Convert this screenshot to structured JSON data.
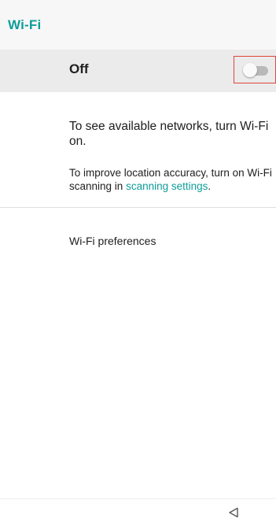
{
  "app_bar": {
    "title": "Wi-Fi"
  },
  "master_switch": {
    "label": "Off",
    "state": "off"
  },
  "info": {
    "primary_text": "To see available networks, turn Wi-Fi on.",
    "secondary_prefix": "To improve location accuracy, turn on Wi-Fi scanning in ",
    "secondary_link": "scanning settings",
    "secondary_suffix": "."
  },
  "preferences": {
    "label": "Wi-Fi preferences"
  },
  "nav_bar": {
    "icons": [
      "back-icon"
    ]
  },
  "colors": {
    "accent": "#0f9d9a",
    "highlight_box": "#e0453a",
    "master_bg": "#ebebeb"
  }
}
